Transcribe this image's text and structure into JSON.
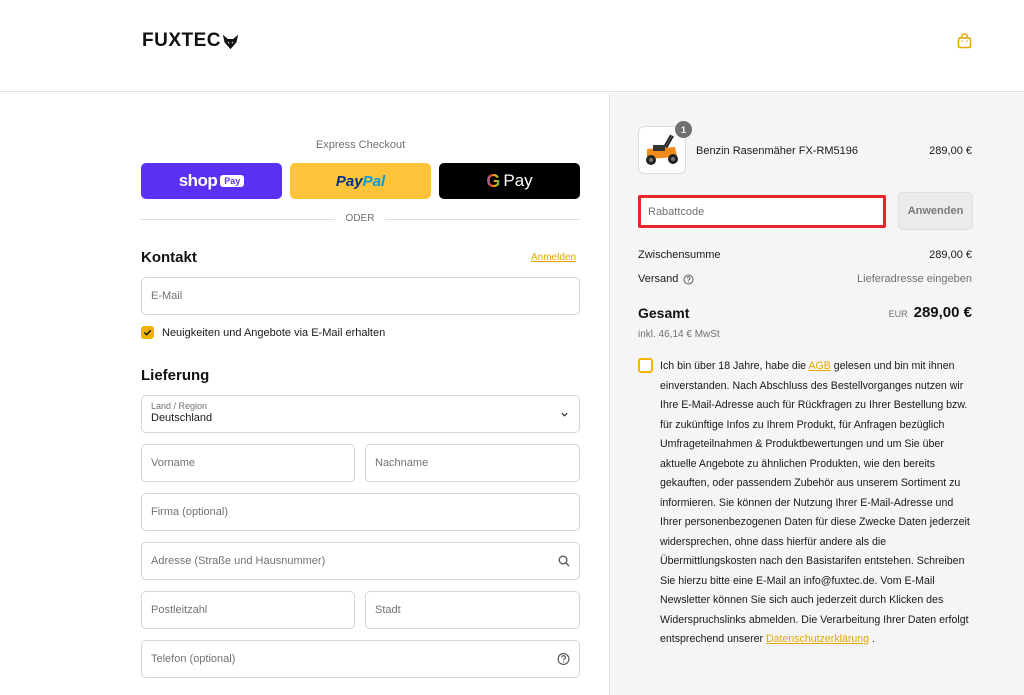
{
  "header": {
    "logo_text": "FUXTEC",
    "cart_icon": "shopping-bag-icon"
  },
  "express": {
    "title": "Express Checkout",
    "shop_pay": {
      "word": "shop",
      "badge": "Pay"
    },
    "paypal": {
      "part1": "Pay",
      "part2": "Pal"
    },
    "gpay": {
      "g": "G",
      "word": "Pay"
    },
    "divider_label": "ODER"
  },
  "contact": {
    "title": "Kontakt",
    "login_link": "Anmelden",
    "email_placeholder": "E-Mail",
    "newsletter_label": "Neuigkeiten und Angebote via E-Mail erhalten",
    "newsletter_checked": true
  },
  "delivery": {
    "title": "Lieferung",
    "country_label": "Land / Region",
    "country_value": "Deutschland",
    "first_name_placeholder": "Vorname",
    "last_name_placeholder": "Nachname",
    "company_placeholder": "Firma (optional)",
    "address_placeholder": "Adresse (Straße und Hausnummer)",
    "zip_placeholder": "Postleitzahl",
    "city_placeholder": "Stadt",
    "phone_placeholder": "Telefon (optional)"
  },
  "order": {
    "product": {
      "name": "Benzin Rasenmäher FX-RM5196",
      "price": "289,00 €",
      "quantity": "1"
    },
    "discount_placeholder": "Rabattcode",
    "apply_label": "Anwenden",
    "subtotal_label": "Zwischensumme",
    "subtotal_value": "289,00 €",
    "shipping_label": "Versand",
    "shipping_value": "Lieferadresse eingeben",
    "total_label": "Gesamt",
    "total_currency": "EUR",
    "total_value": "289,00 €",
    "tax_note": "inkl. 46,14 € MwSt"
  },
  "consent": {
    "text_before": "Ich bin über 18 Jahre, habe die ",
    "agb_link": "AGB",
    "text_middle": " gelesen und bin mit ihnen einverstanden. Nach Abschluss des Bestellvorganges nutzen wir Ihre E-Mail-Adresse auch für Rückfragen zu Ihrer Bestellung bzw. für zukünftige Infos zu Ihrem Produkt, für Anfragen bezüglich Umfrageteilnahmen & Produktbewertungen und um Sie über aktuelle Angebote zu ähnlichen Produkten, wie den bereits gekauften, oder passendem Zubehör aus unserem Sortiment zu informieren. Sie können der Nutzung Ihrer E-Mail-Adresse und Ihrer personenbezogenen Daten für diese Zwecke Daten jederzeit widersprechen, ohne dass hierfür andere als die Übermittlungskosten nach den Basistarifen entstehen. Schreiben Sie hierzu bitte eine E-Mail an info@fuxtec.de. Vom E-Mail Newsletter können Sie sich auch jederzeit durch Klicken des Widerspruchslinks abmelden. Die Verarbeitung Ihrer Daten erfolgt entsprechend unserer ",
    "privacy_link": "Datenschutzerklärung",
    "text_after": " ."
  },
  "colors": {
    "accent": "#f0b400",
    "highlight": "#e8252b",
    "shop_pay": "#5a31f4",
    "paypal": "#ffc439"
  }
}
